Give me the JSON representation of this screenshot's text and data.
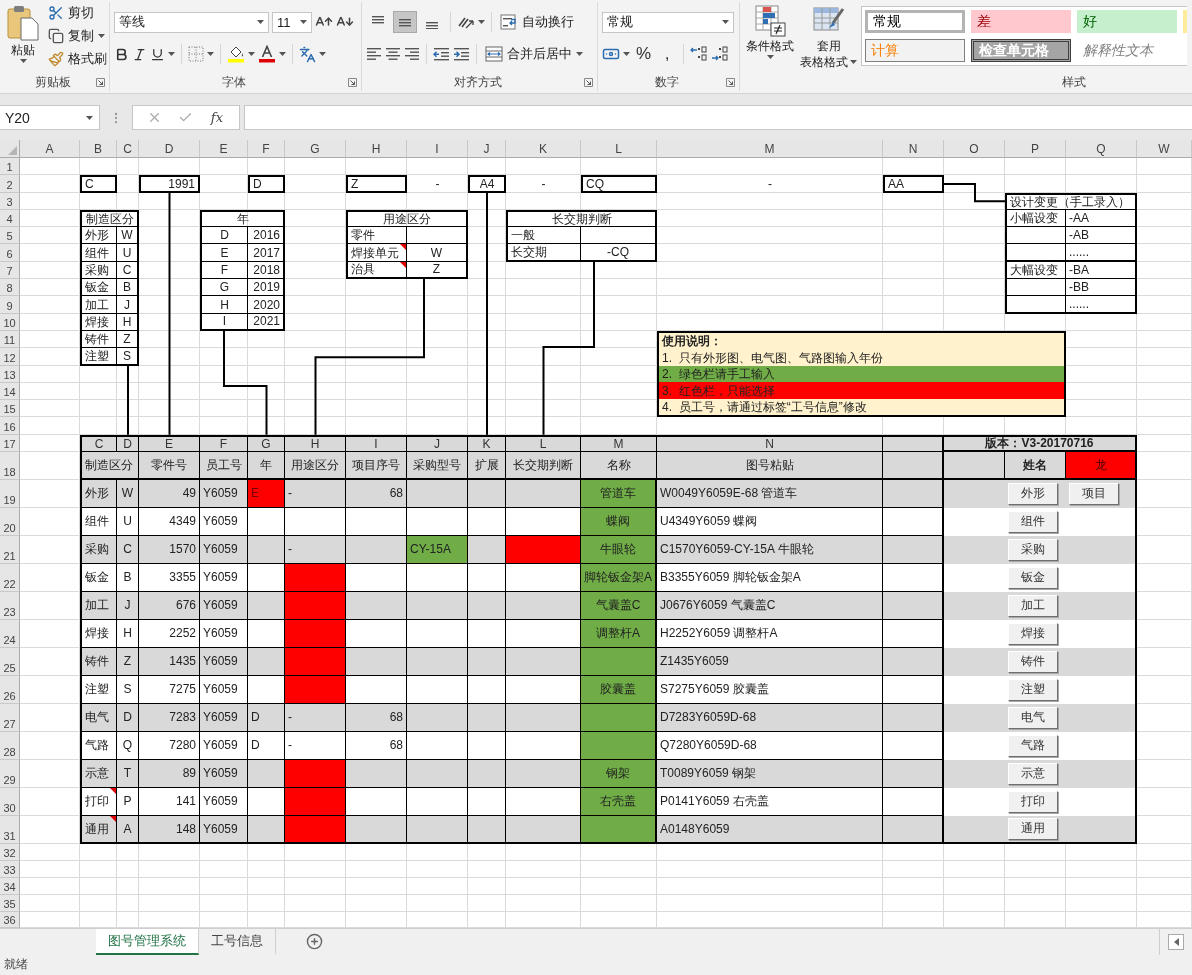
{
  "ribbon": {
    "clipboard": {
      "label": "剪贴板",
      "paste": "粘贴",
      "cut": "剪切",
      "copy": "复制",
      "format_painter": "格式刷"
    },
    "font": {
      "label": "字体",
      "font_name": "等线",
      "font_size": "11"
    },
    "alignment": {
      "label": "对齐方式",
      "vertical_align": [
        {
          "kind": "top",
          "selected": false
        },
        {
          "kind": "middle",
          "selected": true
        },
        {
          "kind": "bottom",
          "selected": false
        }
      ],
      "wrap_text": "自动换行",
      "merge_center": "合并后居中"
    },
    "number": {
      "label": "数字",
      "format": "常规",
      "percent": "%",
      "comma": ","
    },
    "styles": {
      "label": "样式",
      "conditional_format": "条件格式",
      "table_format": [
        "套用",
        "表格格式"
      ],
      "gallery": [
        {
          "kind": "normal",
          "text": "常规",
          "selected": true
        },
        {
          "kind": "bad",
          "text": "差",
          "selected": false
        },
        {
          "kind": "good",
          "text": "好",
          "selected": false
        },
        {
          "kind": "neutral",
          "selected": false
        },
        {
          "kind": "calculation",
          "text": "计算",
          "selected": false
        },
        {
          "kind": "check",
          "text": "检查单元格",
          "selected": false
        },
        {
          "kind": "explanatory",
          "text": "解释性文本",
          "selected": false
        }
      ]
    }
  },
  "formula_bar": {
    "name_box": "Y20",
    "function_button": "fx"
  },
  "sheet": {
    "columns": [
      "A",
      "B",
      "C",
      "D",
      "E",
      "F",
      "G",
      "H",
      "I",
      "J",
      "K",
      "L",
      "M",
      "N",
      "O",
      "P",
      "Q",
      "W"
    ],
    "rows": [
      "1",
      "2",
      "3",
      "4",
      "5",
      "6",
      "7",
      "8",
      "9",
      "10",
      "11",
      "12",
      "13",
      "14",
      "15",
      "16",
      "17",
      "18",
      "19",
      "20",
      "21",
      "22",
      "23",
      "24",
      "25",
      "26",
      "27",
      "28",
      "29",
      "30",
      "31",
      "32",
      "33",
      "34",
      "35",
      "36"
    ],
    "key_boxes": [
      {
        "kind": "box",
        "text": "C"
      },
      {
        "kind": "box",
        "text": "1991"
      },
      {
        "kind": "box",
        "text": "D"
      },
      {
        "kind": "box",
        "text": "Z"
      },
      {
        "kind": "dash",
        "text": "-"
      },
      {
        "kind": "box",
        "text": "A4"
      },
      {
        "kind": "dash",
        "text": "-"
      },
      {
        "kind": "box",
        "text": "CQ"
      },
      {
        "kind": "dash",
        "text": "-"
      },
      {
        "kind": "box",
        "text": "AA"
      }
    ],
    "manufacture_table": {
      "title": "制造区分",
      "rows": [
        {
          "name": "外形",
          "code": "W"
        },
        {
          "name": "组件",
          "code": "U"
        },
        {
          "name": "采购",
          "code": "C"
        },
        {
          "name": "钣金",
          "code": "B"
        },
        {
          "name": "加工",
          "code": "J"
        },
        {
          "name": "焊接",
          "code": "H"
        },
        {
          "name": "铸件",
          "code": "Z"
        },
        {
          "name": "注塑",
          "code": "S"
        }
      ]
    },
    "year_table": {
      "title": "年",
      "rows": [
        {
          "letter": "D",
          "year": "2016"
        },
        {
          "letter": "E",
          "year": "2017"
        },
        {
          "letter": "F",
          "year": "2018"
        },
        {
          "letter": "G",
          "year": "2019"
        },
        {
          "letter": "H",
          "year": "2020"
        },
        {
          "letter": "I",
          "year": "2021"
        }
      ]
    },
    "usage_table": {
      "title": "用途区分",
      "rows": [
        {
          "name": "零件",
          "has_comment": false
        },
        {
          "name": "焊接单元",
          "code": "W",
          "has_comment": true
        },
        {
          "name": "治具",
          "code": "Z",
          "has_comment": true
        }
      ]
    },
    "lead_time_table": {
      "title": "长交期判断",
      "rows": [
        {
          "name": "一般"
        },
        {
          "name": "长交期",
          "code": "-CQ"
        }
      ]
    },
    "design_change_table": {
      "title": "设计变更（手工录入）",
      "groups": [
        {
          "rows": [
            {
              "name": "小幅设变",
              "code": "-AA"
            },
            {
              "code": "-AB"
            },
            {
              "code": "......"
            }
          ]
        },
        {
          "rows": [
            {
              "name": "大幅设变",
              "code": "-BA"
            },
            {
              "code": "-BB"
            },
            {
              "code": "......"
            }
          ]
        }
      ]
    },
    "instructions": {
      "title": "使用说明：",
      "items": [
        {
          "text": "1.  只有外形图、电气图、气路图输入年份",
          "color": "#fff2cc"
        },
        {
          "text": "2.  绿色栏请手工输入",
          "color": "#70ad47"
        },
        {
          "text": "3.  红色栏，只能选择",
          "color": "#ff0000"
        },
        {
          "text": "4.  员工号，请通过标签“工号信息”修改",
          "color": "#fff2cc"
        }
      ]
    },
    "main_table": {
      "column_letters": [
        "C",
        "D",
        "E",
        "F",
        "G",
        "H",
        "I",
        "J",
        "K",
        "L",
        "M",
        "N"
      ],
      "version": "版本：V3-20170716",
      "headers": [
        "制造区分",
        "零件号",
        "员工号",
        "年",
        "用途区分",
        "项目序号",
        "采购型号",
        "扩展",
        "长交期判断",
        "名称",
        "图号粘贴"
      ],
      "name_label": "姓名",
      "name_value": "龙",
      "extra_button": "项目",
      "rows": [
        {
          "has_comment": false,
          "button": "外形",
          "cells": [
            {
              "text": "外形"
            },
            {
              "text": "W"
            },
            {
              "text": "49"
            },
            {
              "text": "Y6059"
            },
            {
              "text": "E",
              "color": "#ff0000"
            },
            {
              "text": "-"
            },
            {
              "text": "68"
            },
            {},
            {},
            {},
            {
              "text": "管道车",
              "color": "#70ad47"
            },
            {
              "text": "W0049Y6059E-68 管道车"
            }
          ]
        },
        {
          "has_comment": false,
          "button": "组件",
          "cells": [
            {
              "text": "组件"
            },
            {
              "text": "U"
            },
            {
              "text": "4349"
            },
            {
              "text": "Y6059"
            },
            {},
            {},
            {},
            {},
            {},
            {},
            {
              "text": "蝶阀",
              "color": "#70ad47"
            },
            {
              "text": "U4349Y6059 蝶阀"
            }
          ]
        },
        {
          "has_comment": false,
          "button": "采购",
          "cells": [
            {
              "text": "采购"
            },
            {
              "text": "C"
            },
            {
              "text": "1570"
            },
            {
              "text": "Y6059"
            },
            {},
            {
              "text": "-"
            },
            {},
            {
              "text": "CY-15A",
              "color": "#70ad47"
            },
            {},
            {
              "color": "#ff0000"
            },
            {
              "text": "牛眼轮",
              "color": "#70ad47"
            },
            {
              "text": "C1570Y6059-CY-15A 牛眼轮"
            }
          ]
        },
        {
          "has_comment": false,
          "button": "钣金",
          "cells": [
            {
              "text": "钣金"
            },
            {
              "text": "B"
            },
            {
              "text": "3355"
            },
            {
              "text": "Y6059"
            },
            {},
            {
              "color": "#ff0000"
            },
            {},
            {},
            {},
            {},
            {
              "text": "脚轮钣金架A",
              "color": "#70ad47"
            },
            {
              "text": "B3355Y6059 脚轮钣金架A"
            }
          ]
        },
        {
          "has_comment": false,
          "button": "加工",
          "cells": [
            {
              "text": "加工"
            },
            {
              "text": "J"
            },
            {
              "text": "676"
            },
            {
              "text": "Y6059"
            },
            {},
            {
              "color": "#ff0000"
            },
            {},
            {},
            {},
            {},
            {
              "text": "气囊盖C",
              "color": "#70ad47"
            },
            {
              "text": "J0676Y6059 气囊盖C"
            }
          ]
        },
        {
          "has_comment": false,
          "button": "焊接",
          "cells": [
            {
              "text": "焊接"
            },
            {
              "text": "H"
            },
            {
              "text": "2252"
            },
            {
              "text": "Y6059"
            },
            {},
            {
              "color": "#ff0000"
            },
            {},
            {},
            {},
            {},
            {
              "text": "调整杆A",
              "color": "#70ad47"
            },
            {
              "text": "H2252Y6059 调整杆A"
            }
          ]
        },
        {
          "has_comment": false,
          "button": "铸件",
          "cells": [
            {
              "text": "铸件"
            },
            {
              "text": "Z"
            },
            {
              "text": "1435"
            },
            {
              "text": "Y6059"
            },
            {},
            {
              "color": "#ff0000"
            },
            {},
            {},
            {},
            {},
            {
              "color": "#70ad47"
            },
            {
              "text": "Z1435Y6059"
            }
          ]
        },
        {
          "has_comment": false,
          "button": "注塑",
          "cells": [
            {
              "text": "注塑"
            },
            {
              "text": "S"
            },
            {
              "text": "7275"
            },
            {
              "text": "Y6059"
            },
            {},
            {
              "color": "#ff0000"
            },
            {},
            {},
            {},
            {},
            {
              "text": "胶囊盖",
              "color": "#70ad47"
            },
            {
              "text": "S7275Y6059 胶囊盖"
            }
          ]
        },
        {
          "has_comment": false,
          "button": "电气",
          "cells": [
            {
              "text": "电气"
            },
            {
              "text": "D"
            },
            {
              "text": "7283"
            },
            {
              "text": "Y6059"
            },
            {
              "text": "D"
            },
            {
              "text": "-"
            },
            {
              "text": "68"
            },
            {},
            {},
            {},
            {
              "color": "#70ad47"
            },
            {
              "text": "D7283Y6059D-68"
            }
          ]
        },
        {
          "has_comment": false,
          "button": "气路",
          "cells": [
            {
              "text": "气路"
            },
            {
              "text": "Q"
            },
            {
              "text": "7280"
            },
            {
              "text": "Y6059"
            },
            {
              "text": "D"
            },
            {
              "text": "-"
            },
            {
              "text": "68"
            },
            {},
            {},
            {},
            {
              "color": "#70ad47"
            },
            {
              "text": "Q7280Y6059D-68"
            }
          ]
        },
        {
          "has_comment": false,
          "button": "示意",
          "cells": [
            {
              "text": "示意"
            },
            {
              "text": "T"
            },
            {
              "text": "89"
            },
            {
              "text": "Y6059"
            },
            {},
            {
              "color": "#ff0000"
            },
            {},
            {},
            {},
            {},
            {
              "text": "钢架",
              "color": "#70ad47"
            },
            {
              "text": "T0089Y6059 钢架"
            }
          ]
        },
        {
          "has_comment": true,
          "button": "打印",
          "cells": [
            {
              "text": "打印"
            },
            {
              "text": "P"
            },
            {
              "text": "141"
            },
            {
              "text": "Y6059"
            },
            {},
            {
              "color": "#ff0000"
            },
            {},
            {},
            {},
            {},
            {
              "text": "右壳盖",
              "color": "#70ad47"
            },
            {
              "text": "P0141Y6059 右壳盖"
            }
          ]
        },
        {
          "has_comment": true,
          "button": "通用",
          "cells": [
            {
              "text": "通用"
            },
            {
              "text": "A"
            },
            {
              "text": "148"
            },
            {
              "text": "Y6059"
            },
            {},
            {
              "color": "#ff0000"
            },
            {},
            {},
            {},
            {},
            {
              "color": "#70ad47"
            },
            {
              "text": "A0148Y6059"
            }
          ]
        }
      ]
    }
  },
  "sheet_tabs": [
    {
      "label": "图号管理系统",
      "selected": true
    },
    {
      "label": "工号信息",
      "selected": false
    }
  ],
  "status_bar": {
    "text": "就绪"
  }
}
